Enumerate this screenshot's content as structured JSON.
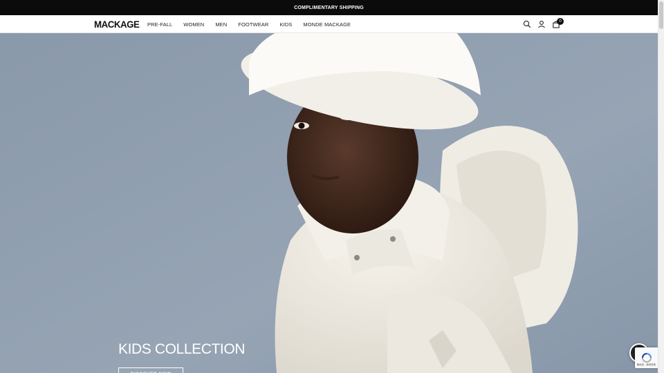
{
  "announcement": {
    "text": "COMPLIMENTARY SHIPPING"
  },
  "header": {
    "logo": "MACKAGE",
    "menu": [
      {
        "label": "PRE-FALL"
      },
      {
        "label": "WOMEN"
      },
      {
        "label": "MEN"
      },
      {
        "label": "FOOTWEAR"
      },
      {
        "label": "KIDS"
      },
      {
        "label": "MONDE MACKAGE"
      }
    ],
    "icons": [
      "search-icon",
      "account-icon",
      "cart-icon"
    ],
    "cart_count": "0"
  },
  "hero": {
    "title": "KIDS COLLECTION",
    "button_label": "DISCOVER NOW"
  },
  "recaptcha": {
    "text": "隐私权 - 使用条款"
  },
  "colors": {
    "announcement_bg": "#0b0b0b",
    "hero_bg": "#8e9cad",
    "text_dark": "#111111"
  }
}
